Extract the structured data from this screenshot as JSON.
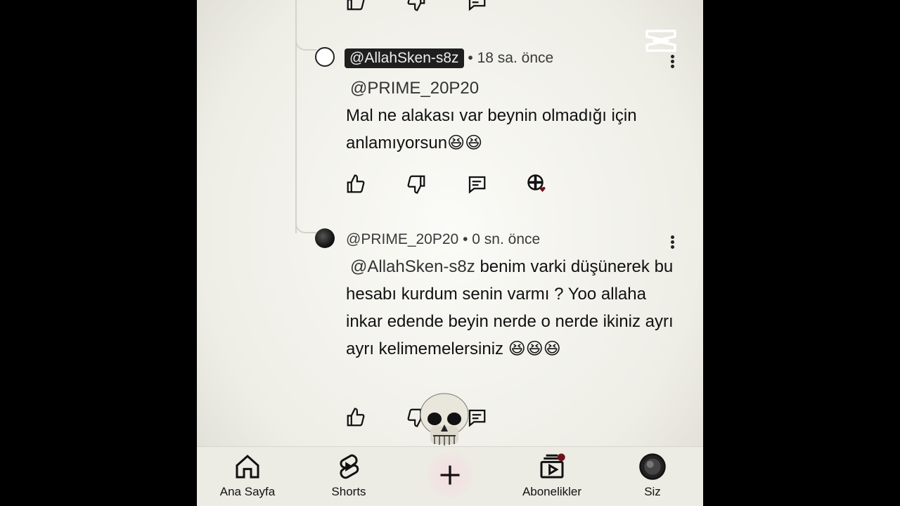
{
  "comments": [
    {
      "handle": "@AllahSken-s8z",
      "separator": "•",
      "time": "18 sa. önce",
      "mention": "@PRIME_20P20",
      "text": "Mal ne alakası var beynin olmadığı için anlamıyorsun",
      "emojis": "😆😆"
    },
    {
      "handle": "@PRIME_20P20",
      "separator": "•",
      "time": "0 sn. önce",
      "mention": "@AllahSken-s8z",
      "text": " benim varki düşünerek bu hesabı kurdum senin varmı ? Yoo allaha inkar edende beyin nerde o nerde ikiniz ayrı ayrı kelimemelersiniz ",
      "emojis": "😆😆😆"
    }
  ],
  "bottom_nav": {
    "home": "Ana Sayfa",
    "shorts": "Shorts",
    "subscriptions": "Abonelikler",
    "you": "Siz"
  }
}
